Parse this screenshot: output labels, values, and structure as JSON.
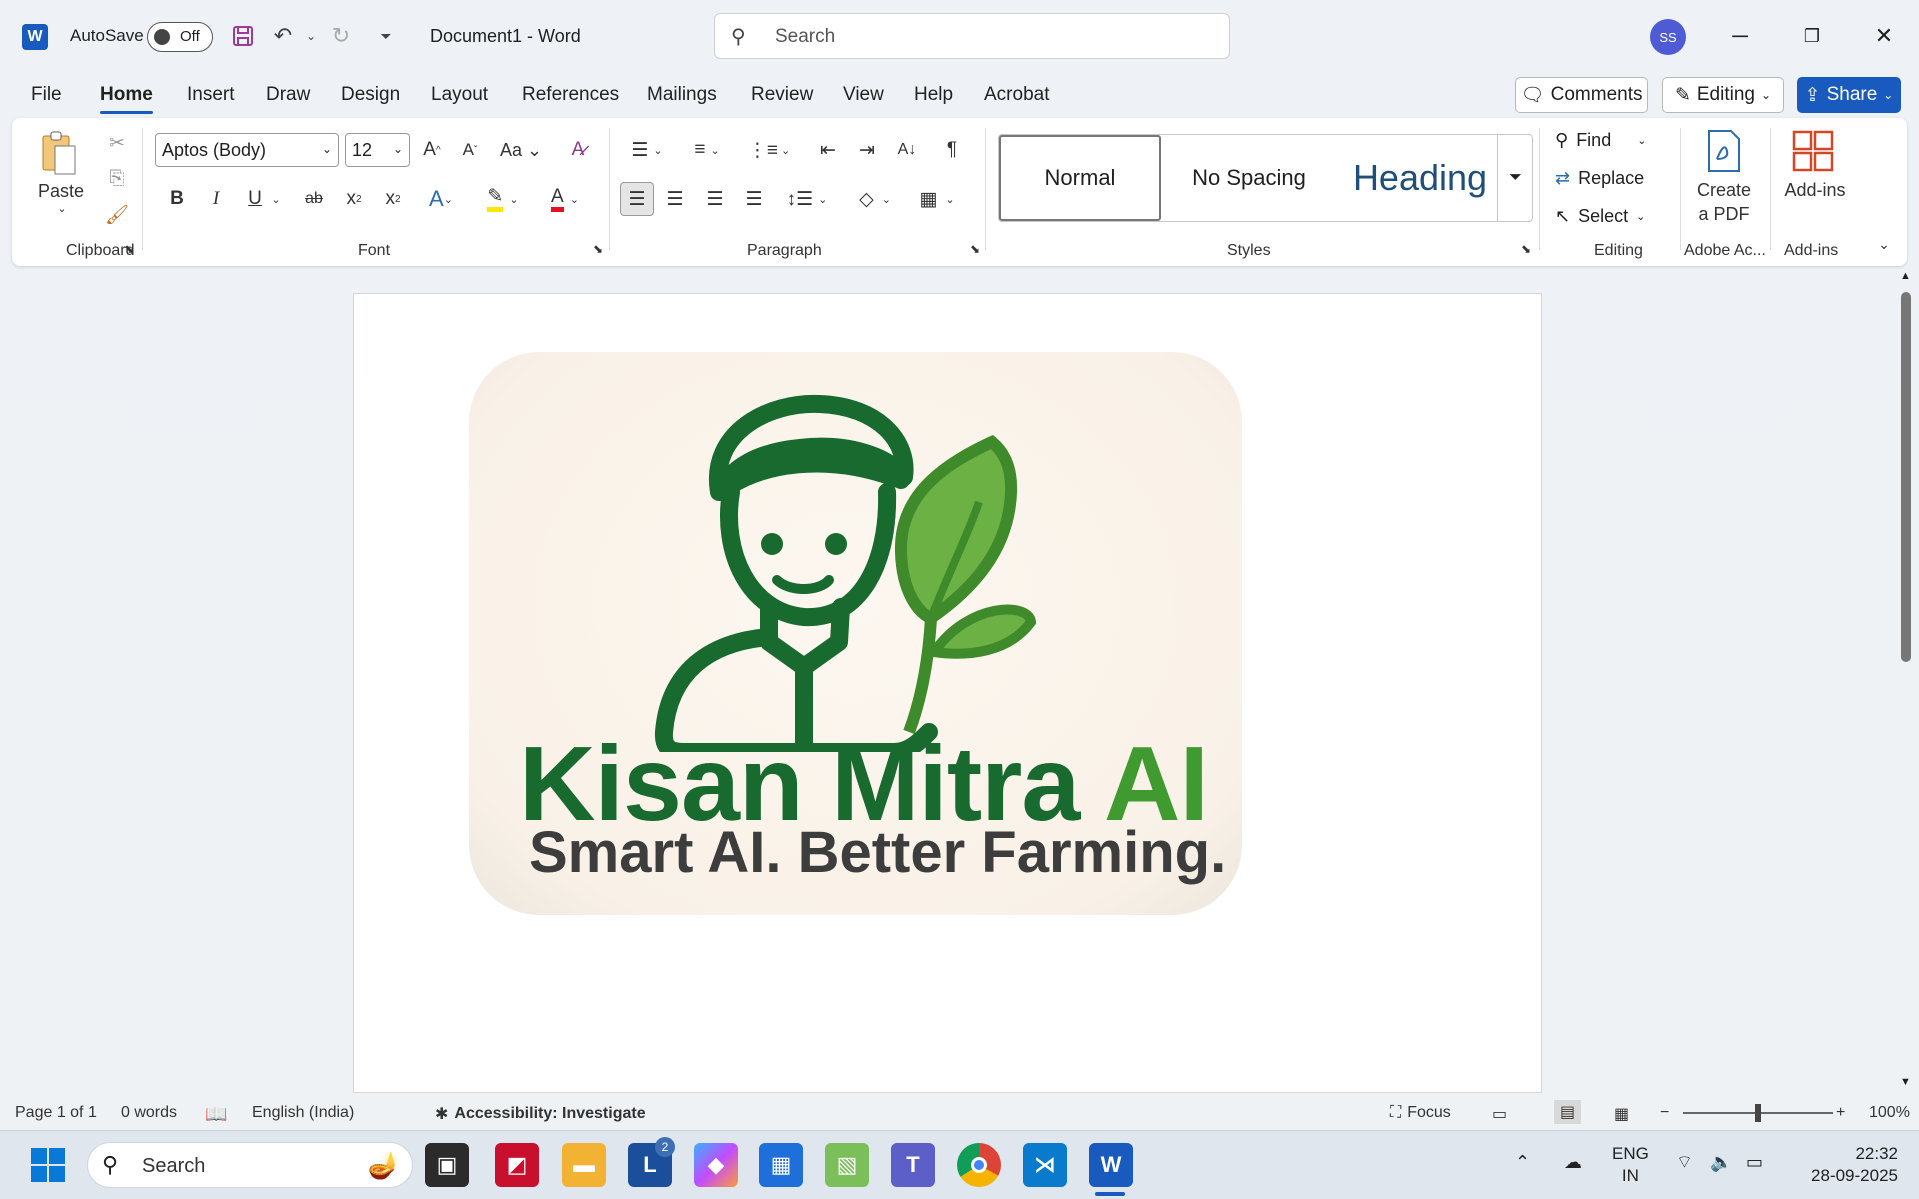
{
  "titlebar": {
    "app_letter": "W",
    "autosave_label": "AutoSave",
    "autosave_state": "Off",
    "document_title": "Document1  -  Word",
    "search_placeholder": "Search",
    "user_initials": "SS"
  },
  "tabs": [
    "File",
    "Home",
    "Insert",
    "Draw",
    "Design",
    "Layout",
    "References",
    "Mailings",
    "Review",
    "View",
    "Help",
    "Acrobat"
  ],
  "active_tab": "Home",
  "top_buttons": {
    "comments": "Comments",
    "editing": "Editing",
    "share": "Share"
  },
  "ribbon": {
    "clipboard": {
      "label": "Clipboard",
      "paste": "Paste"
    },
    "font": {
      "label": "Font",
      "font_name": "Aptos (Body)",
      "font_size": "12"
    },
    "paragraph": {
      "label": "Paragraph"
    },
    "styles": {
      "label": "Styles",
      "items": [
        "Normal",
        "No Spacing",
        "Heading"
      ]
    },
    "editing": {
      "label": "Editing",
      "find": "Find",
      "replace": "Replace",
      "select": "Select"
    },
    "adobe": {
      "label": "Adobe Ac...",
      "create_pdf_line1": "Create",
      "create_pdf_line2": "a PDF"
    },
    "addins": {
      "label": "Add-ins",
      "button": "Add-ins"
    }
  },
  "document": {
    "brand_main": "Kisan Mitra",
    "brand_ai": "AI",
    "tagline": "Smart AI. Better Farming."
  },
  "statusbar": {
    "page": "Page 1 of 1",
    "words": "0 words",
    "language": "English (India)",
    "accessibility": "Accessibility: Investigate",
    "focus": "Focus",
    "zoom": "100%"
  },
  "taskbar": {
    "search": "Search",
    "teams_badge": "2",
    "lang_line1": "ENG",
    "lang_line2": "IN",
    "time": "22:32",
    "date": "28-09-2025"
  },
  "colors": {
    "accent": "#185abd",
    "brand_dark_green": "#186a2f",
    "brand_light_green": "#3f9a2f",
    "tagline_gray": "#3d3d3d"
  }
}
